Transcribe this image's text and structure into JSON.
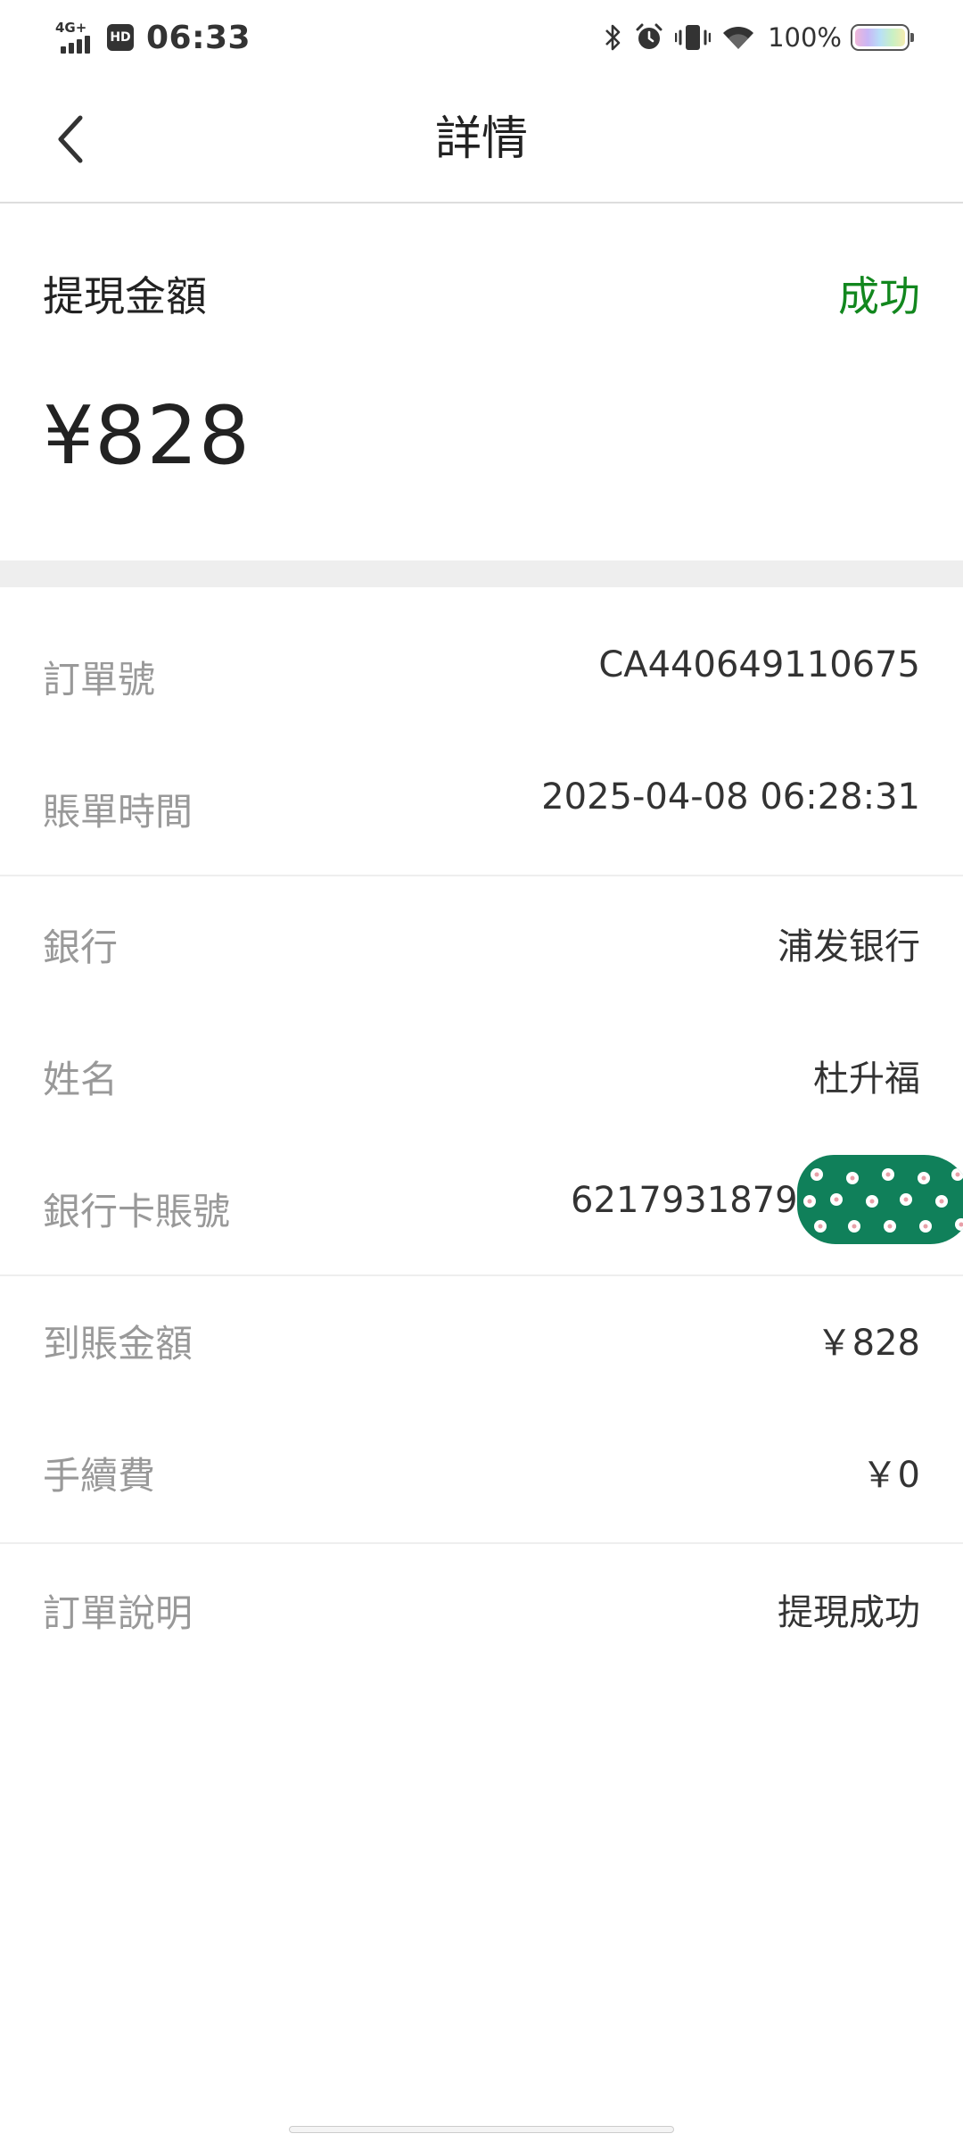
{
  "status_bar": {
    "network": "4G+",
    "hd_label": "HD",
    "time": "06:33",
    "battery_percent": "100%",
    "icons": [
      "bluetooth-icon",
      "alarm-icon",
      "vibrate-icon",
      "wifi-icon",
      "battery-icon"
    ]
  },
  "header": {
    "title": "詳情",
    "back_icon": "chevron-left-icon"
  },
  "summary": {
    "label": "提現金額",
    "status": "成功",
    "status_color": "#12871e",
    "amount": "¥828"
  },
  "details": {
    "order_no": {
      "label": "訂單號",
      "value": "CA440649110675"
    },
    "bill_time": {
      "label": "賬單時間",
      "value": "2025-04-08 06:28:31"
    },
    "bank": {
      "label": "銀行",
      "value": "浦发银行"
    },
    "name": {
      "label": "姓名",
      "value": "杜升福"
    },
    "card_no": {
      "label": "銀行卡賬號",
      "value": "62179318792"
    },
    "received_amount": {
      "label": "到賬金額",
      "value": "￥828"
    },
    "fee": {
      "label": "手續費",
      "value": "￥0"
    },
    "order_note": {
      "label": "訂單說明",
      "value": "提現成功"
    }
  }
}
